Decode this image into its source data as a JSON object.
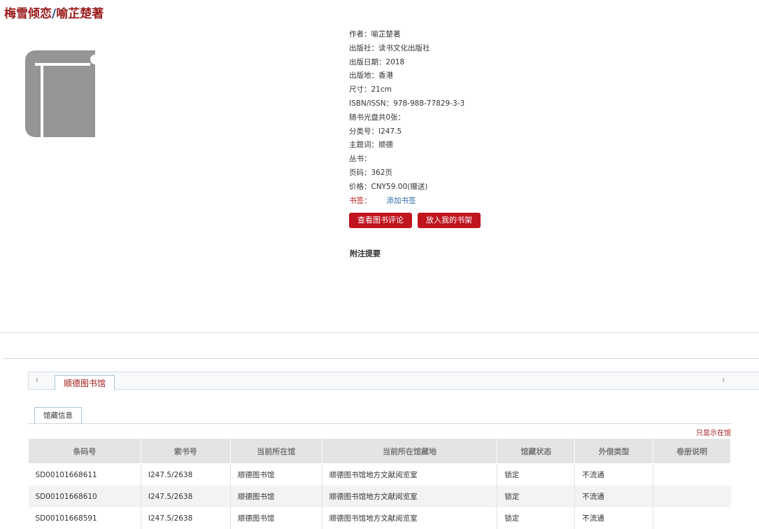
{
  "book": {
    "title_main": "梅雪倾恋",
    "title_sep": "/",
    "title_author": "喻芷楚著"
  },
  "info": [
    "作者：喻芷楚著",
    "出版社：读书文化出版社",
    "出版日期：2018",
    "出版地：香港",
    "尺寸：21cm",
    "ISBN/ISSN：978-988-77829-3-3",
    "随书光盘共0张：",
    "分类号：I247.5",
    "主题词：顺德",
    "丛书：",
    "页码：362页",
    "价格：CNY59.00(赠送)"
  ],
  "bookmark": {
    "label": "书签：",
    "link": "添加书签"
  },
  "buttons": {
    "reviews": "查看图书评论",
    "shelf": "放入我的书架"
  },
  "abstract_heading": "附注提要",
  "library_tab": "顺德图书馆",
  "holdings_tab": "馆藏信息",
  "only_in_library": "只显示在馆",
  "table": {
    "headers": [
      "条码号",
      "索书号",
      "当前所在馆",
      "当前所在馆藏地",
      "馆藏状态",
      "外借类型",
      "卷册说明"
    ],
    "rows": [
      [
        "SD00101668611",
        "I247.5/2638",
        "顺德图书馆",
        "顺德图书馆地方文献阅览室",
        "锁定",
        "不流通",
        ""
      ],
      [
        "SD00101668610",
        "I247.5/2638",
        "顺德图书馆",
        "顺德图书馆地方文献阅览室",
        "锁定",
        "不流通",
        ""
      ],
      [
        "SD00101668591",
        "I247.5/2638",
        "顺德图书馆",
        "顺德图书馆地方文献阅览室",
        "锁定",
        "不流通",
        ""
      ]
    ]
  },
  "icons": {
    "cover": "book-icon",
    "prev": "chevron-left-icon",
    "next": "chevron-right-icon"
  },
  "colors": {
    "accent": "#c0141f",
    "title": "#9a1b1b",
    "link": "#2c6aa8"
  }
}
